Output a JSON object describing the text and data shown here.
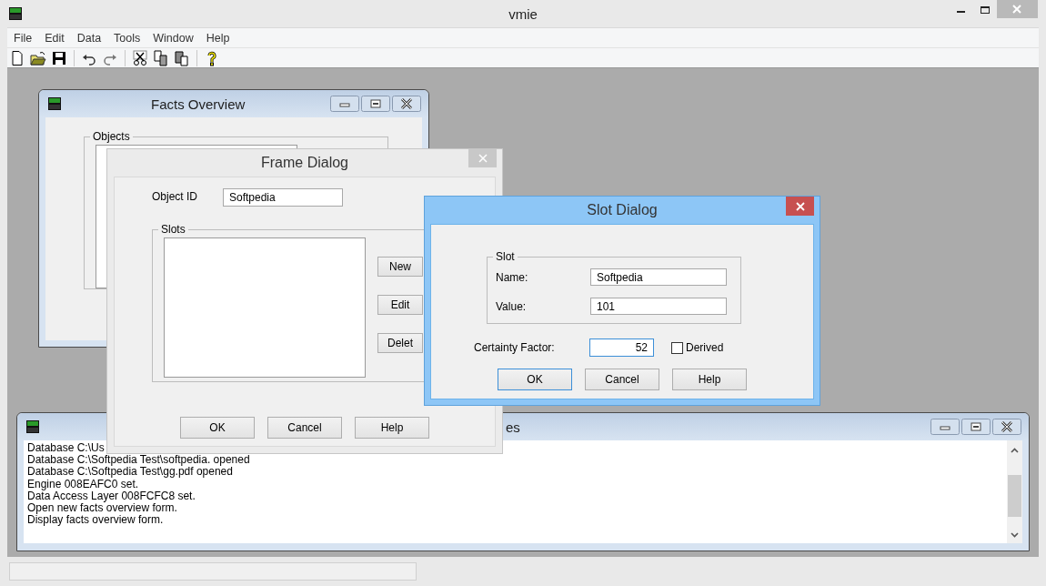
{
  "app": {
    "title": "vmie"
  },
  "menu": [
    "File",
    "Edit",
    "Data",
    "Tools",
    "Window",
    "Help"
  ],
  "facts_overview": {
    "title": "Facts Overview",
    "objects_group": "Objects"
  },
  "log_window": {
    "title": "es",
    "lines": [
      "Database C:\\Us",
      "Database C:\\Softpedia Test\\softpedia. opened",
      "Database C:\\Softpedia Test\\gg.pdf opened",
      "Engine 008EAFC0 set.",
      "Data Access Layer 008FCFC8 set.",
      "Open new facts overview form.",
      "Display facts overview form."
    ]
  },
  "frame_dialog": {
    "title": "Frame Dialog",
    "object_id_label": "Object ID",
    "object_id_value": "Softpedia",
    "slots_group": "Slots",
    "side_buttons": [
      "New",
      "Edit",
      "Delet"
    ],
    "buttons": [
      "OK",
      "Cancel",
      "Help"
    ]
  },
  "slot_dialog": {
    "title": "Slot Dialog",
    "slot_group": "Slot",
    "name_label": "Name:",
    "name_value": "Softpedia",
    "value_label": "Value:",
    "value_value": "101",
    "certainty_label": "Certainty Factor:",
    "certainty_value": "52",
    "derived": {
      "label": "Derived",
      "checked": false
    },
    "buttons": [
      {
        "label": "OK",
        "default": true
      },
      {
        "label": "Cancel",
        "default": false
      },
      {
        "label": "Help",
        "default": false
      }
    ]
  }
}
